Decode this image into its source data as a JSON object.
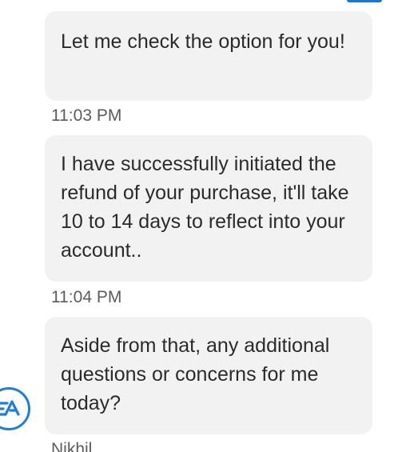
{
  "messages": [
    {
      "text": "Let me check the option for you!",
      "timestamp": "11:03 PM"
    },
    {
      "text": "I have successfully initiated the refund of your purchase, it'll take 10 to 14 days to reflect into your account..",
      "timestamp": "11:04 PM"
    },
    {
      "text": "Aside from that, any additional questions or concerns for me today?"
    }
  ],
  "agent": {
    "name": "Nikhil",
    "avatar_logo_text": "EA",
    "avatar_color": "#1e7fd9"
  },
  "colors": {
    "bubble_background": "#f2f2f2",
    "message_text": "#2b2b2b",
    "timestamp_text": "#5c5c5c",
    "accent": "#1976d2"
  }
}
